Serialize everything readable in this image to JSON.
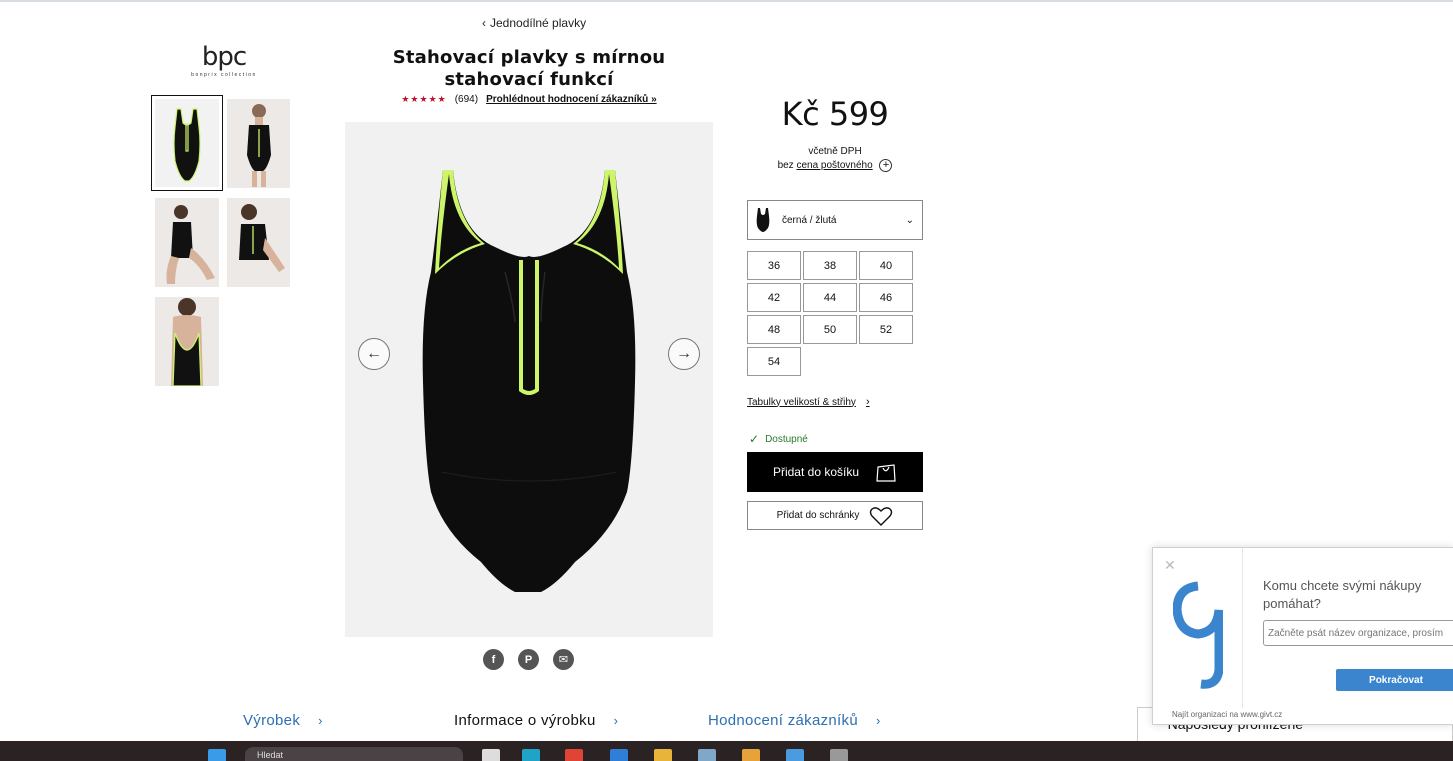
{
  "breadcrumb": {
    "label": "Jednodílné plavky"
  },
  "logo": {
    "main": "bpc",
    "sub": "bonprix collection"
  },
  "product": {
    "title": "Stahovací plavky s mírnou stahovací funkcí",
    "rating_count": "(694)",
    "rating_link": "Prohlédnout hodnocení zákazníků »",
    "stars": "★★★★★"
  },
  "price": {
    "amount": "Kč 599",
    "vat_note": "včetně DPH",
    "shipping_prefix": "bez",
    "shipping_link": "cena poštovného"
  },
  "color": {
    "selected": "černá / žlutá"
  },
  "sizes": [
    "36",
    "38",
    "40",
    "42",
    "44",
    "46",
    "48",
    "50",
    "52",
    "54"
  ],
  "size_table_link": "Tabulky velikostí & střihy",
  "availability": "Dostupné",
  "buttons": {
    "add_to_cart": "Přidat do košíku",
    "add_to_wishlist": "Přidat do schránky"
  },
  "tabs": [
    {
      "label": "Výrobek"
    },
    {
      "label": "Informace o výrobku"
    },
    {
      "label": "Hodnocení zákazníků"
    }
  ],
  "recently_viewed": "Naposledy prohlížené",
  "givt": {
    "question": "Komu chcete svými nákupy pomáhat?",
    "placeholder": "Začněte psát název organizace, prosím",
    "continue": "Pokračovat",
    "footer": "Najít organizaci na www.givt.cz"
  },
  "taskbar": {
    "search_placeholder": "Hledat"
  },
  "colors": {
    "accent_blue": "#2c6fb3",
    "stars_red": "#c0102b",
    "neon_trim": "#cdf56a",
    "givt_blue": "#3b85cf"
  },
  "icons": [
    "chevron-left-icon",
    "arrow-left-icon",
    "arrow-right-icon",
    "facebook-icon",
    "pinterest-icon",
    "email-icon",
    "chevron-down-icon",
    "check-icon",
    "shopping-bag-icon",
    "heart-icon",
    "close-icon",
    "plus-circle-icon",
    "chevron-right-icon",
    "chevron-up-icon"
  ]
}
